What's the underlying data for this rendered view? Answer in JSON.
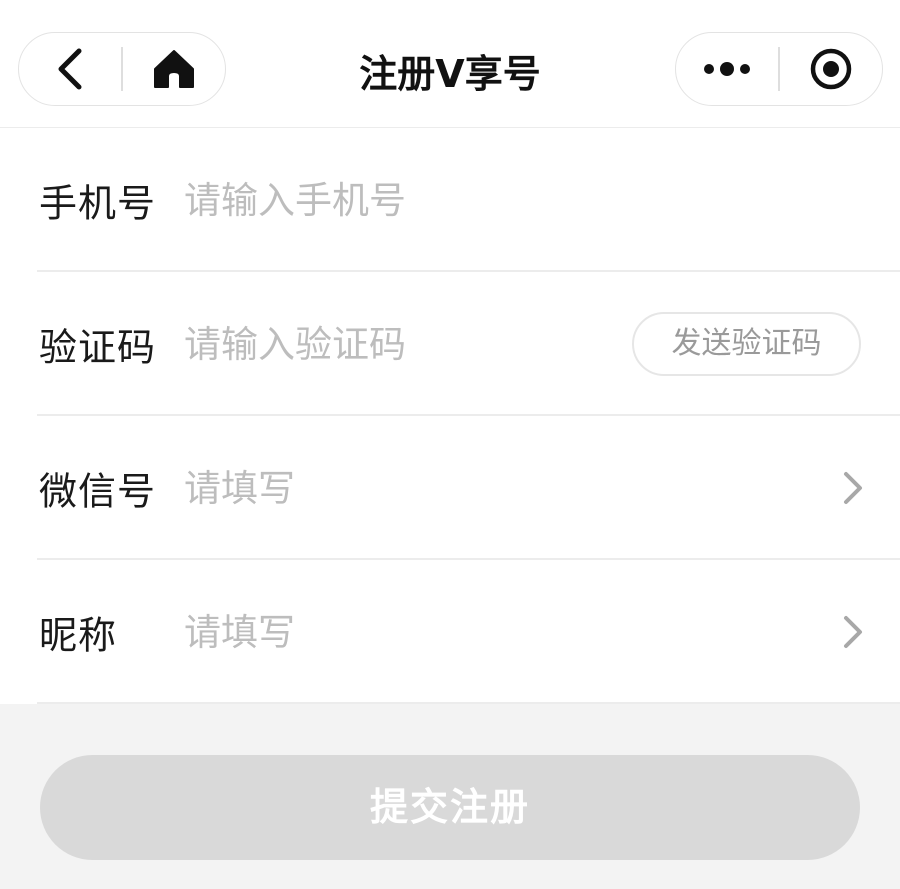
{
  "navbar": {
    "title": "注册V享号",
    "left_capsule": {
      "back_icon": "chevron-left-icon",
      "home_icon": "home-icon"
    },
    "right_capsule": {
      "more_icon": "more-dots-icon",
      "close_icon": "target-circle-icon"
    }
  },
  "form": {
    "phone": {
      "label": "手机号",
      "placeholder": "请输入手机号",
      "value": ""
    },
    "code": {
      "label": "验证码",
      "placeholder": "请输入验证码",
      "value": "",
      "send_button": "发送验证码"
    },
    "wechat": {
      "label": "微信号",
      "placeholder": "请填写",
      "value": "",
      "arrow_icon": "chevron-right-icon"
    },
    "nickname": {
      "label": "昵称",
      "placeholder": "请填写",
      "value": "",
      "arrow_icon": "chevron-right-icon"
    }
  },
  "submit": {
    "label": "提交注册"
  },
  "colors": {
    "background": "#f3f3f3",
    "surface": "#ffffff",
    "placeholder": "#bdbdbd",
    "submit_disabled": "#d9d9d9"
  }
}
